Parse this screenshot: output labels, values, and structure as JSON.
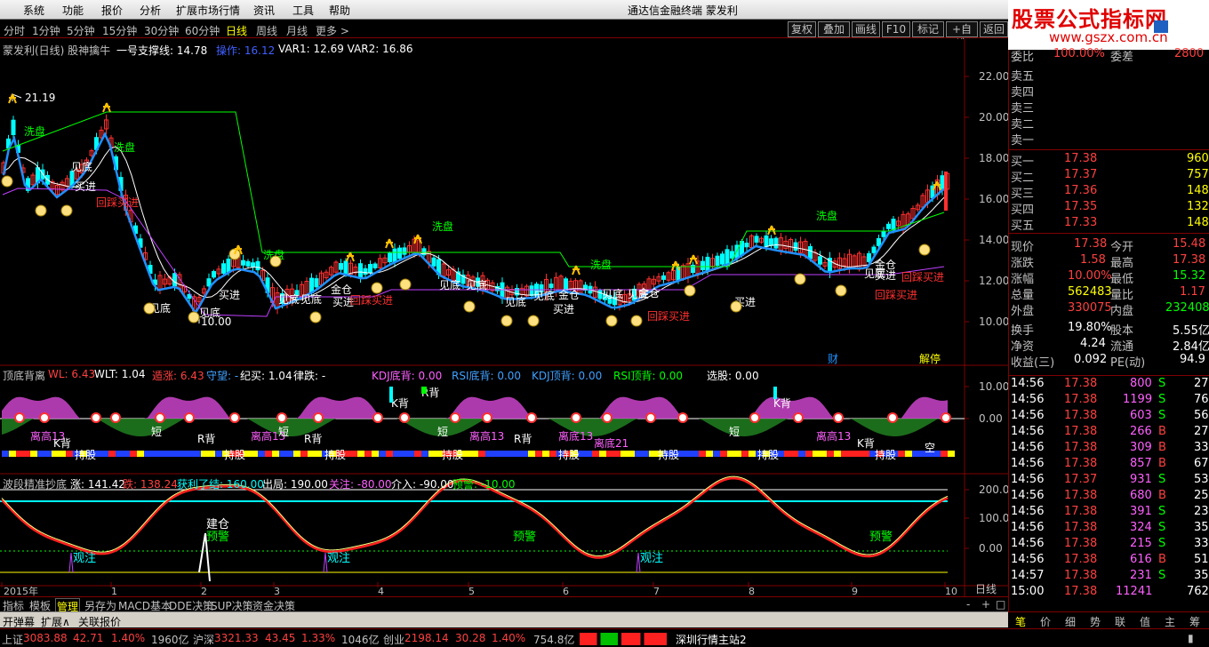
{
  "menu": {
    "items": [
      "系统",
      "功能",
      "报价",
      "分析",
      "扩展市场行情",
      "资讯",
      "工具",
      "帮助"
    ],
    "window_title": "通达信金融终端    蒙发利",
    "controls": [
      "_",
      "□",
      "×"
    ]
  },
  "watermark": {
    "line1": "股票公式指标网",
    "line2": "www.gszx.com.cn"
  },
  "period": {
    "items": [
      "分时",
      "1分钟",
      "5分钟",
      "15分钟",
      "30分钟",
      "60分钟",
      "日线",
      "周线",
      "月线",
      "更多 >"
    ],
    "active": "日线",
    "buttons": [
      "复权",
      "叠加",
      "画线",
      "F10",
      "标记",
      "+自选",
      "返回"
    ]
  },
  "main_info": {
    "name": "蒙发利(日线) 股神擒牛",
    "support": "一号支撑线: 14.78",
    "operate": "操作: 16.12",
    "var": "VAR1: 12.69  VAR2: 16.86"
  },
  "colors": {
    "up": "#ff3030",
    "down": "#00ffff",
    "accent": "#ffff00",
    "grid": "#800000",
    "magenta": "#ff60ff",
    "green": "#00ff00"
  },
  "price_axis": [
    "22.00",
    "20.00",
    "18.00",
    "16.00",
    "14.00",
    "12.00",
    "10.00"
  ],
  "price_labels": {
    "high": "21.19",
    "low": "10.00"
  },
  "chart_annotations": {
    "xi": "洗盘",
    "jd": "见底",
    "mr": "买进",
    "hc": "回踩买进",
    "jc": "金仓",
    "cai": "财",
    "jie": "解停"
  },
  "ind1": {
    "title": "顶底背离",
    "wl": "WL: 6.43",
    "wlt": "WLT: 1.04",
    "ds": "遁涨: 6.43",
    "sw": "守望: -",
    "jm": "纪买: 1.04",
    "ld": "律跌: -",
    "kdj_d": "KDJ底背: 0.00",
    "rsi_d": "RSI底背: 0.00",
    "kdj_t": "KDJ顶背: 0.00",
    "rsi_t": "RSI顶背: 0.00",
    "xg": "选股: 0.00",
    "axis": [
      "10.00",
      "0.00"
    ],
    "labels": [
      "K背",
      "R背",
      "持股",
      "离高13",
      "离底13",
      "离底21",
      "短",
      "空"
    ]
  },
  "ind2": {
    "title": "波段精准抄底",
    "zhang": "涨: 141.42",
    "die": "跌: 138.24",
    "hl": "获利了结: 160.00",
    "cj": "出局: 190.00",
    "gz": "关注: -80.00",
    "jr": "介入: -90.00",
    "yj": "预警: -10.00",
    "axis": [
      "200.0",
      "100.0",
      "0.00"
    ],
    "labels": [
      "建仓",
      "预警",
      "观注"
    ]
  },
  "time_axis": [
    "2015年",
    "1",
    "2",
    "3",
    "4",
    "5",
    "6",
    "7",
    "8",
    "9",
    "10"
  ],
  "bottom_tabs": [
    "指标",
    "模板",
    "管理",
    "另存为",
    "MACD基本",
    "DDE决策",
    "SUP决策",
    "资金决策"
  ],
  "tool_row": [
    "开弹幕",
    "扩展∧",
    "关联报价"
  ],
  "quote": {
    "wb": [
      "委比",
      "100.00%",
      "委差",
      "2800"
    ],
    "sells": [
      "卖五",
      "卖四",
      "卖三",
      "卖二",
      "卖一"
    ],
    "buys": [
      [
        "买一",
        "17.38",
        "960"
      ],
      [
        "买二",
        "17.37",
        "757"
      ],
      [
        "买三",
        "17.36",
        "148"
      ],
      [
        "买四",
        "17.35",
        "132"
      ],
      [
        "买五",
        "17.33",
        "148"
      ]
    ],
    "stats": [
      [
        "现价",
        "17.38",
        "今开",
        "15.48"
      ],
      [
        "涨跌",
        "1.58",
        "最高",
        "17.38"
      ],
      [
        "涨幅",
        "10.00%",
        "最低",
        "15.32"
      ],
      [
        "总量",
        "562483",
        "量比",
        "1.17"
      ],
      [
        "外盘",
        "330075",
        "内盘",
        "232408"
      ],
      [
        "换手",
        "19.80%",
        "股本",
        "5.55亿"
      ],
      [
        "净资",
        "4.24",
        "流通",
        "2.84亿"
      ],
      [
        "收益(三)",
        "0.092",
        "PE(动)",
        "94.9"
      ]
    ],
    "ticks": [
      [
        "14:56",
        "17.38",
        "800",
        "S",
        "27"
      ],
      [
        "14:56",
        "17.38",
        "1199",
        "S",
        "76"
      ],
      [
        "14:56",
        "17.38",
        "603",
        "S",
        "56"
      ],
      [
        "14:56",
        "17.38",
        "266",
        "B",
        "27"
      ],
      [
        "14:56",
        "17.38",
        "309",
        "B",
        "33"
      ],
      [
        "14:56",
        "17.38",
        "857",
        "B",
        "67"
      ],
      [
        "14:56",
        "17.37",
        "931",
        "S",
        "53"
      ],
      [
        "14:56",
        "17.38",
        "680",
        "B",
        "25"
      ],
      [
        "14:56",
        "17.38",
        "391",
        "S",
        "23"
      ],
      [
        "14:56",
        "17.38",
        "324",
        "S",
        "35"
      ],
      [
        "14:56",
        "17.38",
        "215",
        "S",
        "33"
      ],
      [
        "14:56",
        "17.38",
        "616",
        "B",
        "51"
      ],
      [
        "14:57",
        "17.38",
        "231",
        "S",
        "35"
      ],
      [
        "15:00",
        "17.38",
        "11241",
        "",
        "762"
      ]
    ],
    "tabs": [
      "笔",
      "价",
      "细",
      "势",
      "联",
      "值",
      "主",
      "筹"
    ],
    "day_tag": "日线"
  },
  "status": {
    "sh": "上证",
    "sh_v": "3083.88",
    "sh_c": "42.71",
    "sh_p": "1.40%",
    "sh_a": "1960亿",
    "hs": "沪深",
    "hs_v": "3321.33",
    "hs_c": "43.45",
    "hs_p": "1.33%",
    "hs_a": "1046亿",
    "cy": "创业",
    "cy_v": "2198.14",
    "cy_c": "30.28",
    "cy_p": "1.40%",
    "cy_a": "754.8亿",
    "site": "深圳行情主站2"
  }
}
